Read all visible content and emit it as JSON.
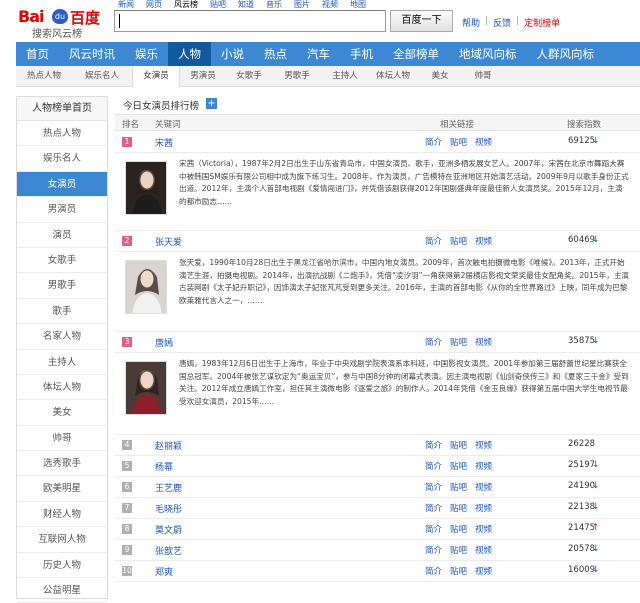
{
  "header": {
    "logo_bai": "Bai",
    "logo_paw": "du",
    "logo_du": "百度",
    "logo_sub": "搜索风云榜",
    "top_nav": [
      "新闻",
      "网页",
      "风云榜",
      "贴吧",
      "知道",
      "音乐",
      "图片",
      "视频",
      "地图"
    ],
    "search_button": "百度一下",
    "links": {
      "help": "帮助",
      "sep1": "|",
      "feedback": "反馈",
      "sep2": "|",
      "subscribe": "定制榜单"
    }
  },
  "main_nav": [
    "首页",
    "风云时讯",
    "娱乐",
    "人物",
    "小说",
    "热点",
    "汽车",
    "手机",
    "全部榜单",
    "地域风向标",
    "人群风向标"
  ],
  "sub_nav": [
    "热点人物",
    "娱乐名人",
    "女演员",
    "男演员",
    "女歌手",
    "男歌手",
    "主持人",
    "体坛人物",
    "美女",
    "帅哥"
  ],
  "sidebar": {
    "header": "人物榜单首页",
    "items": [
      "热点人物",
      "娱乐名人",
      "女演员",
      "男演员",
      "演员",
      "女歌手",
      "男歌手",
      "歌手",
      "名家人物",
      "主持人",
      "体坛人物",
      "美女",
      "帅哥",
      "选秀歌手",
      "欧美明星",
      "财经人物",
      "互联网人物",
      "历史人物",
      "公益明星"
    ]
  },
  "list": {
    "title": "今日女演员排行榜",
    "plus": "+",
    "columns": {
      "rank": "排名",
      "keyword": "关键词",
      "links": "相关链接",
      "index": "搜索指数"
    },
    "link_labels": [
      "简介",
      "贴吧",
      "视频"
    ],
    "rows": [
      {
        "rank": "1",
        "name": "宋茜",
        "index": "69125",
        "trend": "down",
        "desc": "宋茜（Victoria），1987年2月2日出生于山东省青岛市，中国女演员、歌手，亚洲多栖发展女艺人。2007年，宋茜在北京市舞蹈大赛中被韩国SM娱乐有限公司相中成为旗下练习生。2008年，作为演员，广告模特在亚洲地区开始演艺活动。2009年9月以歌手身份正式出道。2012年，主演个人首部电视剧《爱情闯进门》，并凭借该剧获得2012年国剧盛典年度最佳新人女演员奖。2015年12月，主演的都市励志……"
      },
      {
        "rank": "2",
        "name": "张天爱",
        "index": "60469",
        "trend": "down",
        "desc": "张天爱，1990年10月28日出生于黑龙江省哈尔滨市，中国内地女演员。2009年，首次触电拍摄微电影《唯候》。2013年，正式开始演艺生涯，拍摄电视剧。2014年，出演抗战剧《二炮手》，凭借“凌汐羽”一角获得第2届横店影视文荣奖最佳女配角奖。2015年，主演古装网剧《太子妃升职记》，因饰演太子妃张芃芃受到更多关注。2016年，主演的首部电影《从你的全世界路过》上映，同年成为巴黎欧莱雅代言人之一，……"
      },
      {
        "rank": "3",
        "name": "唐嫣",
        "index": "35875",
        "trend": "down",
        "desc": "唐嫣，1983年12月6日出生于上海市，毕业于中央戏剧学院表演系本科班，中国影视女演员。2001年参加第三届舒蕾世纪星比赛获全国总冠军。2004年被张艺谋钦定为“奥运宝贝”，参与中国8分钟的闭幕式表演。因主演电视剧《仙剑奇侠传三》和《夏家三千金》受到关注。2012年成立唐嫣工作室，担任其主演微电影《逐爱之旅》的制作人。2014年凭借《金玉良缘》获得第五届中国大学生电视节最受欢迎女演员，2015年……"
      },
      {
        "rank": "4",
        "name": "赵丽颖",
        "index": "26228",
        "trend": "none"
      },
      {
        "rank": "5",
        "name": "杨幂",
        "index": "25197",
        "trend": "down"
      },
      {
        "rank": "6",
        "name": "王艺鹿",
        "index": "24190",
        "trend": "down"
      },
      {
        "rank": "7",
        "name": "毛晓彤",
        "index": "22138",
        "trend": "down"
      },
      {
        "rank": "8",
        "name": "莫文蔚",
        "index": "21475",
        "trend": "up"
      },
      {
        "rank": "9",
        "name": "张歆艺",
        "index": "20578",
        "trend": "down"
      },
      {
        "rank": "10",
        "name": "郑爽",
        "index": "16009",
        "trend": "down"
      }
    ]
  },
  "colors": {
    "nav_blue": "#3d88d3",
    "nav_active": "#12599f",
    "rank_top": "#e06186",
    "rank_other": "#b0b0b0",
    "link": "#1a55c4",
    "trend_up": "#e10601",
    "trend_down": "#1a55c4"
  },
  "icons": {
    "trend_down": "down-arrow-icon",
    "trend_up": "up-arrow-icon"
  }
}
